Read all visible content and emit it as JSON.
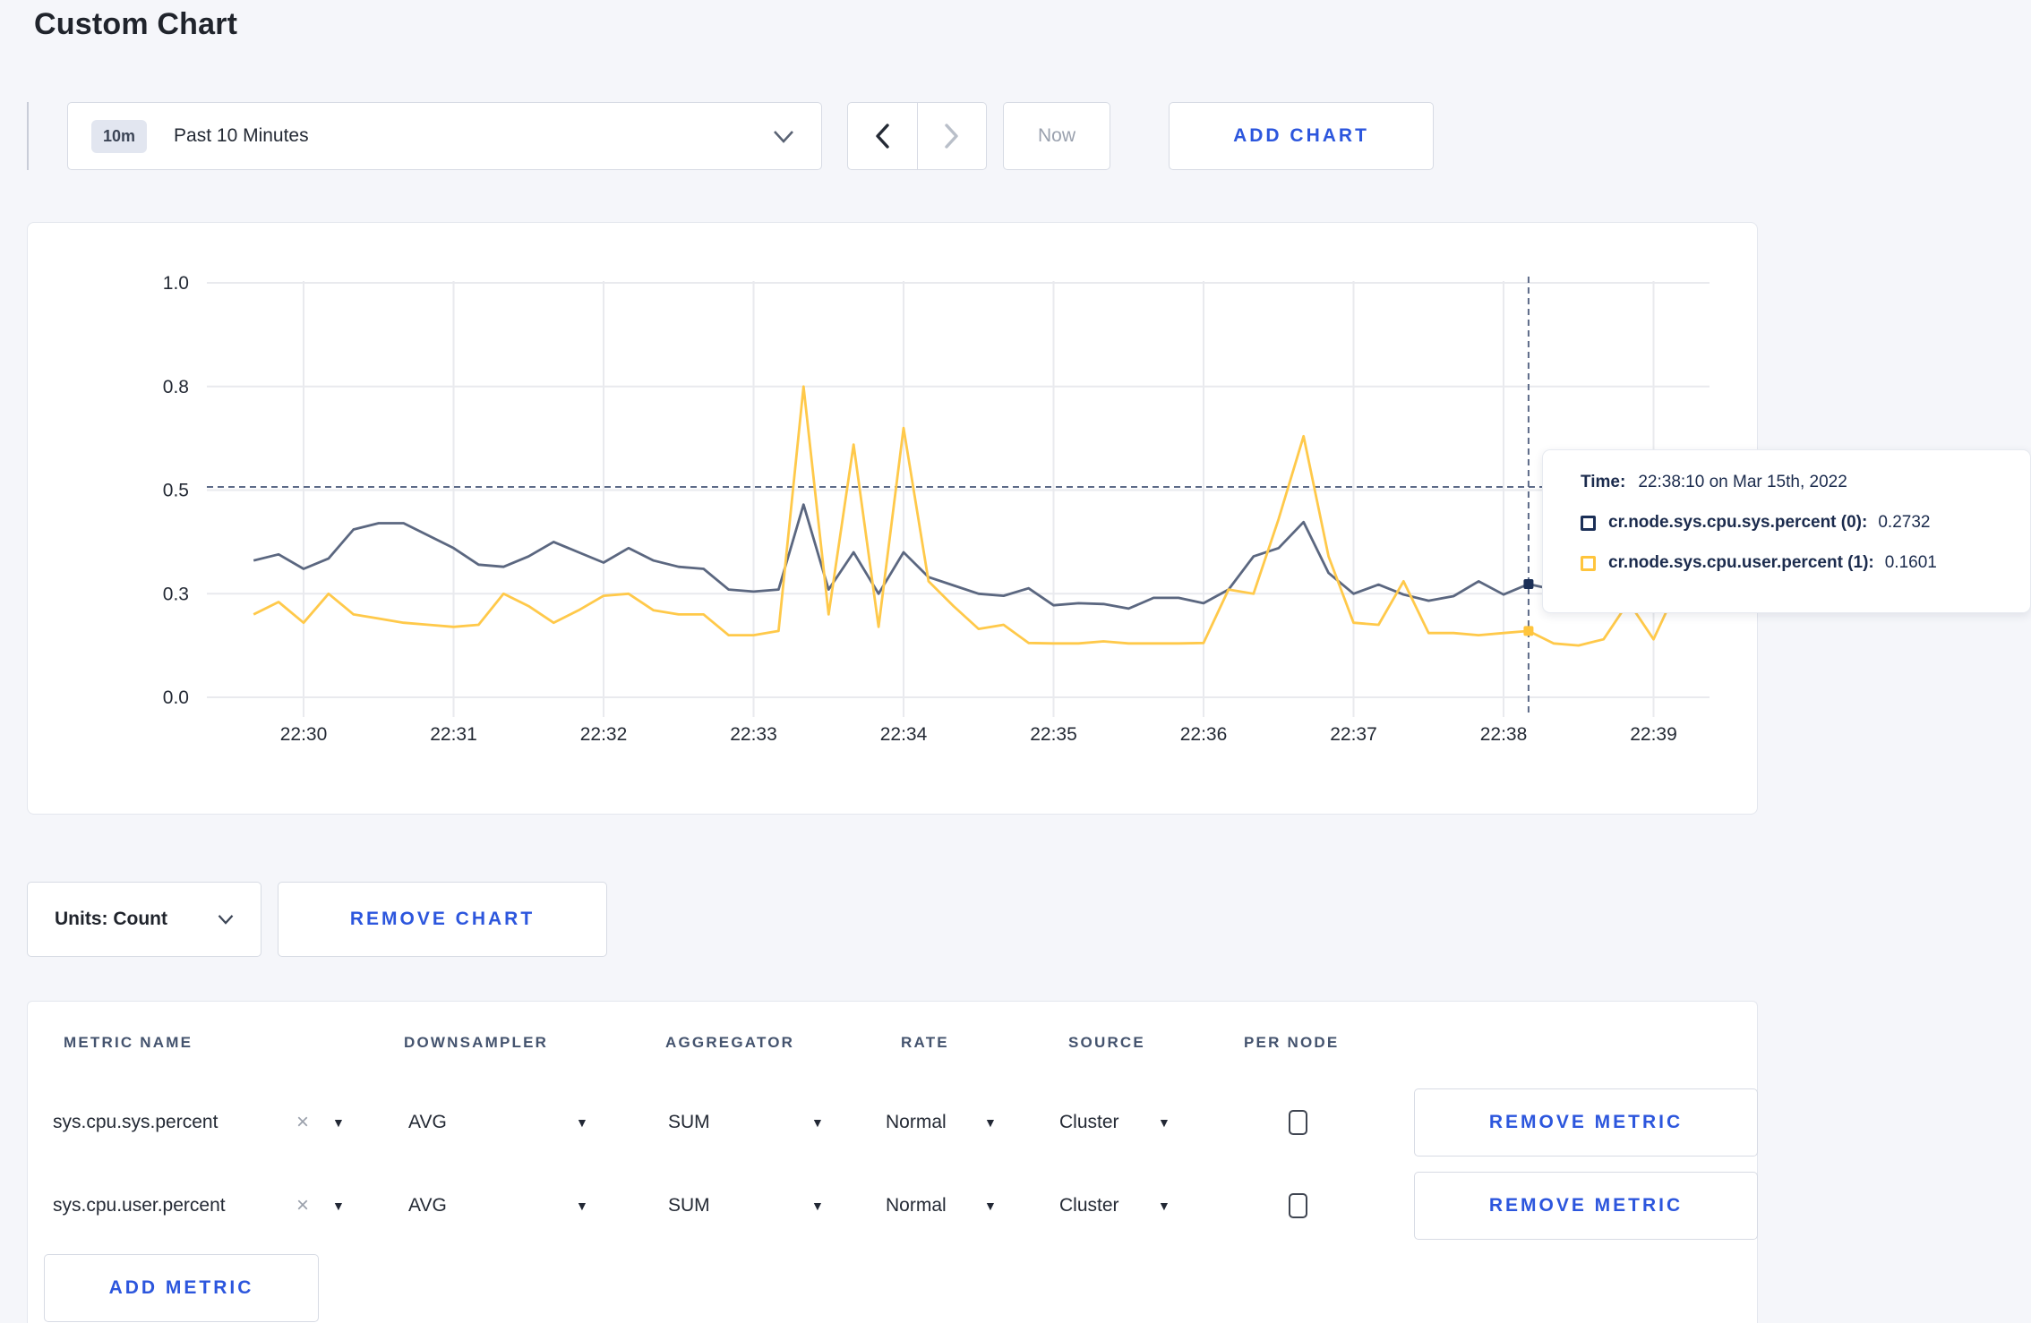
{
  "page": {
    "title": "Custom Chart"
  },
  "toolbar": {
    "time_range": {
      "badge": "10m",
      "label": "Past 10 Minutes"
    },
    "now_label": "Now",
    "add_chart_label": "ADD CHART"
  },
  "units": {
    "label": "Units: Count"
  },
  "remove_chart_label": "REMOVE CHART",
  "colors": {
    "accent_blue": "#2c56dd",
    "series_sys": "#5b6780",
    "series_user": "#ffc94a",
    "tooltip_swatch_sys": "#1b2f57",
    "tooltip_swatch_user": "#ffc53d",
    "gridline": "#e9eaee",
    "crosshair": "#5d6b88"
  },
  "chart_data": {
    "type": "line",
    "title": "",
    "xlabel": "",
    "ylabel": "",
    "ylim": [
      0,
      1
    ],
    "grid": true,
    "legend_position": "none",
    "yticks": [
      {
        "value": 0.0,
        "label": "0.0"
      },
      {
        "value": 0.25,
        "label": "0.3"
      },
      {
        "value": 0.5,
        "label": "0.5"
      },
      {
        "value": 0.75,
        "label": "0.8"
      },
      {
        "value": 1.0,
        "label": "1.0"
      }
    ],
    "xticks": [
      "22:30",
      "22:31",
      "22:32",
      "22:33",
      "22:34",
      "22:35",
      "22:36",
      "22:37",
      "22:38",
      "22:39"
    ],
    "x": [
      "22:29:40",
      "22:29:50",
      "22:30:00",
      "22:30:10",
      "22:30:20",
      "22:30:30",
      "22:30:40",
      "22:30:50",
      "22:31:00",
      "22:31:10",
      "22:31:20",
      "22:31:30",
      "22:31:40",
      "22:31:50",
      "22:32:00",
      "22:32:10",
      "22:32:20",
      "22:32:30",
      "22:32:40",
      "22:32:50",
      "22:33:00",
      "22:33:10",
      "22:33:20",
      "22:33:30",
      "22:33:40",
      "22:33:50",
      "22:34:00",
      "22:34:10",
      "22:34:20",
      "22:34:30",
      "22:34:40",
      "22:34:50",
      "22:35:00",
      "22:35:10",
      "22:35:20",
      "22:35:30",
      "22:35:40",
      "22:35:50",
      "22:36:00",
      "22:36:10",
      "22:36:20",
      "22:36:30",
      "22:36:40",
      "22:36:50",
      "22:37:00",
      "22:37:10",
      "22:37:20",
      "22:37:30",
      "22:37:40",
      "22:37:50",
      "22:38:00",
      "22:38:10",
      "22:38:20",
      "22:38:30",
      "22:38:40",
      "22:38:50",
      "22:39:00",
      "22:39:10"
    ],
    "series": [
      {
        "name": "cr.node.sys.cpu.sys.percent",
        "values": [
          0.33,
          0.345,
          0.31,
          0.335,
          0.405,
          0.42,
          0.42,
          0.39,
          0.36,
          0.32,
          0.315,
          0.34,
          0.375,
          0.35,
          0.325,
          0.36,
          0.33,
          0.315,
          0.31,
          0.26,
          0.255,
          0.26,
          0.465,
          0.26,
          0.35,
          0.25,
          0.35,
          0.29,
          0.27,
          0.25,
          0.245,
          0.263,
          0.222,
          0.227,
          0.225,
          0.214,
          0.24,
          0.24,
          0.227,
          0.26,
          0.34,
          0.36,
          0.423,
          0.3,
          0.25,
          0.272,
          0.248,
          0.233,
          0.244,
          0.28,
          0.248,
          0.2732,
          0.26,
          0.27,
          0.28,
          0.27,
          0.3,
          0.31
        ]
      },
      {
        "name": "cr.node.sys.cpu.user.percent",
        "values": [
          0.2,
          0.23,
          0.18,
          0.25,
          0.2,
          0.19,
          0.18,
          0.175,
          0.17,
          0.175,
          0.25,
          0.22,
          0.18,
          0.21,
          0.245,
          0.25,
          0.21,
          0.2,
          0.2,
          0.15,
          0.15,
          0.16,
          0.75,
          0.2,
          0.61,
          0.17,
          0.65,
          0.28,
          0.22,
          0.165,
          0.175,
          0.131,
          0.13,
          0.13,
          0.135,
          0.13,
          0.13,
          0.13,
          0.131,
          0.26,
          0.25,
          0.43,
          0.63,
          0.34,
          0.18,
          0.175,
          0.28,
          0.155,
          0.155,
          0.15,
          0.155,
          0.1601,
          0.13,
          0.125,
          0.14,
          0.23,
          0.14,
          0.27
        ]
      }
    ],
    "hover": {
      "index": 51,
      "crosshair_y_value": 0.5075,
      "time_label_key": "Time:",
      "time_label_value": "22:38:10 on Mar 15th, 2022",
      "rows": [
        {
          "label": "cr.node.sys.cpu.sys.percent (0):",
          "value": "0.2732"
        },
        {
          "label": "cr.node.sys.cpu.user.percent (1):",
          "value": "0.1601"
        }
      ]
    }
  },
  "metrics_table": {
    "headers": [
      "METRIC NAME",
      "DOWNSAMPLER",
      "AGGREGATOR",
      "RATE",
      "SOURCE",
      "PER NODE"
    ],
    "rows": [
      {
        "metric_name": "sys.cpu.sys.percent",
        "downsampler": "AVG",
        "aggregator": "SUM",
        "rate": "Normal",
        "source": "Cluster",
        "per_node_checked": false,
        "remove_label": "REMOVE METRIC"
      },
      {
        "metric_name": "sys.cpu.user.percent",
        "downsampler": "AVG",
        "aggregator": "SUM",
        "rate": "Normal",
        "source": "Cluster",
        "per_node_checked": false,
        "remove_label": "REMOVE METRIC"
      }
    ],
    "add_metric_label": "ADD METRIC"
  }
}
